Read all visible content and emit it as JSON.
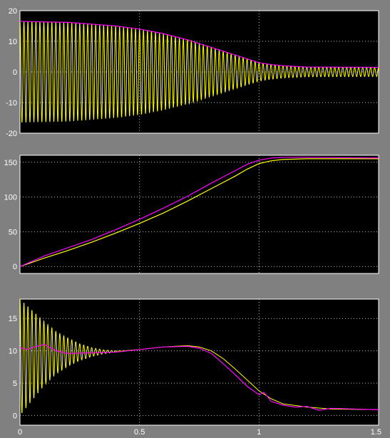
{
  "chart_data": [
    {
      "type": "line",
      "xlim": [
        0,
        1.5
      ],
      "ylim": [
        -20,
        20
      ],
      "x_ticks": [
        "0",
        "0.5",
        "1",
        "1.5"
      ],
      "y_ticks": [
        "20",
        "10",
        "0",
        "-10",
        "-20"
      ],
      "grid": true,
      "background": "#000000",
      "series": [
        {
          "color": "#ffff00",
          "style": "oscillation",
          "frequency_hz": 60,
          "offset_points": {
            "x": [
              0,
              1.5
            ],
            "y": [
              0,
              0
            ]
          },
          "amplitude_points": {
            "x": [
              0,
              0.2,
              0.4,
              0.5,
              0.6,
              0.7,
              0.8,
              0.9,
              1.0,
              1.05,
              1.1,
              1.2,
              1.5
            ],
            "y": [
              16.5,
              16.2,
              15.0,
              14.0,
              12.5,
              10.5,
              8.0,
              5.5,
              3.0,
              2.4,
              2.0,
              1.6,
              1.5
            ]
          }
        },
        {
          "color": "#ff00ff",
          "style": "line",
          "x": [
            0,
            0.2,
            0.4,
            0.5,
            0.6,
            0.7,
            0.8,
            0.9,
            1.0,
            1.05,
            1.1,
            1.2,
            1.5
          ],
          "y": [
            16.5,
            16.2,
            15.0,
            14.0,
            12.5,
            10.5,
            8.0,
            5.5,
            3.0,
            2.4,
            2.0,
            1.6,
            1.5
          ]
        }
      ]
    },
    {
      "type": "line",
      "xlim": [
        0,
        1.5
      ],
      "ylim": [
        -10,
        160
      ],
      "x_ticks": [
        "0",
        "0.5",
        "1",
        "1.5"
      ],
      "y_ticks": [
        "150",
        "100",
        "50",
        "0"
      ],
      "grid": true,
      "background": "#000000",
      "series": [
        {
          "color": "#ffff00",
          "style": "line",
          "x": [
            0,
            0.1,
            0.2,
            0.3,
            0.4,
            0.5,
            0.6,
            0.7,
            0.8,
            0.9,
            0.95,
            1.0,
            1.05,
            1.1,
            1.2,
            1.5
          ],
          "y": [
            0,
            12,
            23,
            35,
            48,
            62,
            77,
            94,
            112,
            130,
            140,
            148,
            152,
            154,
            155,
            155
          ]
        },
        {
          "color": "#ff00ff",
          "style": "line",
          "x": [
            0,
            0.1,
            0.2,
            0.3,
            0.4,
            0.5,
            0.6,
            0.7,
            0.8,
            0.9,
            0.95,
            1.0,
            1.05,
            1.1,
            1.2,
            1.5
          ],
          "y": [
            0,
            15,
            27,
            39,
            53,
            68,
            84,
            101,
            120,
            138,
            147,
            153,
            156,
            157,
            157,
            156
          ]
        }
      ]
    },
    {
      "type": "line",
      "xlim": [
        0,
        1.5
      ],
      "ylim": [
        -1.5,
        18
      ],
      "x_ticks": [
        "0",
        "0.5",
        "1",
        "1.5"
      ],
      "y_ticks": [
        "15",
        "10",
        "5",
        "0"
      ],
      "grid": true,
      "background": "#000000",
      "series": [
        {
          "color": "#ffff00",
          "style": "oscillation",
          "frequency_hz": 60,
          "offset_points": {
            "x": [
              0,
              0.1,
              0.2,
              0.3,
              0.4,
              0.5,
              0.6,
              0.7,
              0.75,
              0.8,
              0.85,
              0.9,
              0.95,
              1.0,
              1.05,
              1.1,
              1.2,
              1.3,
              1.5
            ],
            "y": [
              9.0,
              9.6,
              9.8,
              9.8,
              9.9,
              10.2,
              10.6,
              10.8,
              10.6,
              10.0,
              8.8,
              7.2,
              5.5,
              3.8,
              2.6,
              1.8,
              1.3,
              1.0,
              0.9
            ]
          },
          "amplitude_points": {
            "x": [
              0,
              0.05,
              0.1,
              0.15,
              0.2,
              0.25,
              0.3,
              0.35,
              0.4,
              0.45,
              1.5
            ],
            "y": [
              9.0,
              7.0,
              5.0,
              3.3,
              2.2,
              1.3,
              0.7,
              0.3,
              0.1,
              0,
              0
            ]
          }
        },
        {
          "color": "#ff00ff",
          "style": "line",
          "x": [
            0,
            0.03,
            0.06,
            0.1,
            0.15,
            0.2,
            0.3,
            0.4,
            0.5,
            0.6,
            0.7,
            0.75,
            0.8,
            0.85,
            0.9,
            0.95,
            1.0,
            1.02,
            1.05,
            1.1,
            1.15,
            1.2,
            1.25,
            1.3,
            1.4,
            1.5
          ],
          "y": [
            10.5,
            10.2,
            10.6,
            11.0,
            10.0,
            9.6,
            9.7,
            9.8,
            10.2,
            10.6,
            10.7,
            10.4,
            9.6,
            8.0,
            6.3,
            4.5,
            3.2,
            3.6,
            2.2,
            1.6,
            1.3,
            1.4,
            0.8,
            1.1,
            1.0,
            0.9
          ]
        }
      ]
    }
  ]
}
